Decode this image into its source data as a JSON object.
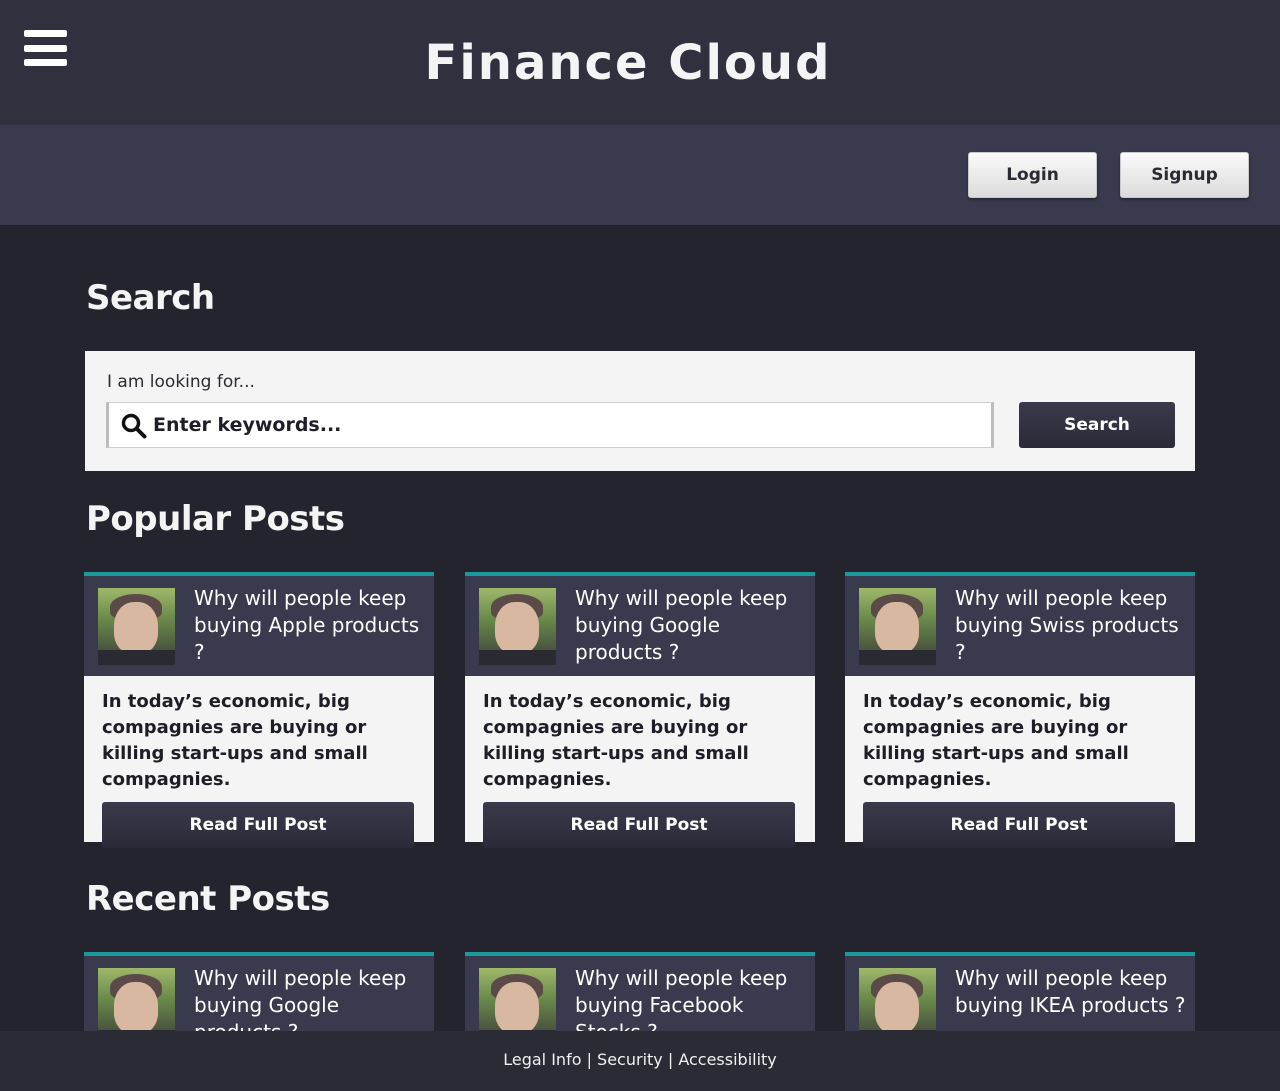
{
  "header": {
    "title": "Finance Cloud",
    "login_label": "Login",
    "signup_label": "Signup"
  },
  "search": {
    "heading": "Search",
    "label": "I am looking for...",
    "placeholder": "Enter keywords...",
    "button_label": "Search"
  },
  "popular": {
    "heading": "Popular Posts",
    "posts": [
      {
        "title": "Why will people keep buying Apple products ?",
        "excerpt": "In today’s economic, big compagnies are buying or killing start-ups and small compagnies.",
        "button_label": "Read Full Post"
      },
      {
        "title": "Why will people keep buying Google products ?",
        "excerpt": "In today’s economic, big compagnies are buying or killing start-ups and small compagnies.",
        "button_label": "Read Full Post"
      },
      {
        "title": "Why will people keep buying Swiss products ?",
        "excerpt": "In today’s economic, big compagnies are buying or killing start-ups and small compagnies.",
        "button_label": "Read Full Post"
      }
    ]
  },
  "recent": {
    "heading": "Recent Posts",
    "posts": [
      {
        "title": "Why will people keep buying Google products ?"
      },
      {
        "title": "Why will people keep buying Facebook Stocks ?"
      },
      {
        "title": "Why will people keep buying IKEA products ?"
      }
    ]
  },
  "footer": {
    "legal": "Legal Info",
    "security": "Security",
    "accessibility": "Accessibility",
    "separator": " | "
  },
  "colors": {
    "accent": "#1a9a9a",
    "header_bg": "#30303f",
    "subbar_bg": "#3a3a4e",
    "page_bg": "#24242f"
  },
  "icons": {
    "menu": "hamburger-menu-icon",
    "search": "magnifier-icon"
  }
}
